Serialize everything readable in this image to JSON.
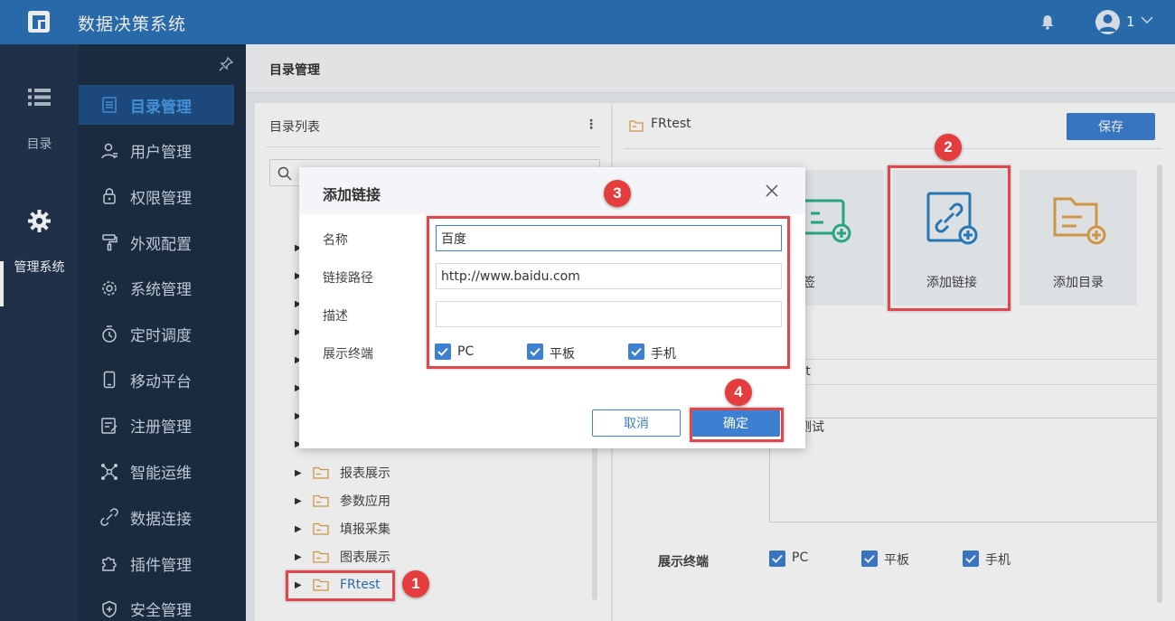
{
  "app": {
    "title": "数据决策系统",
    "user_name": "1"
  },
  "left_strip": {
    "items": [
      {
        "label": "目录"
      },
      {
        "label": "管理系统"
      }
    ]
  },
  "sidebar": {
    "items": [
      {
        "label": "目录管理",
        "icon": "list-icon"
      },
      {
        "label": "用户管理",
        "icon": "user-icon"
      },
      {
        "label": "权限管理",
        "icon": "lock-icon"
      },
      {
        "label": "外观配置",
        "icon": "paint-roller-icon"
      },
      {
        "label": "系统管理",
        "icon": "gear-icon"
      },
      {
        "label": "定时调度",
        "icon": "timer-icon"
      },
      {
        "label": "移动平台",
        "icon": "mobile-icon"
      },
      {
        "label": "注册管理",
        "icon": "register-icon"
      },
      {
        "label": "智能运维",
        "icon": "network-icon"
      },
      {
        "label": "数据连接",
        "icon": "link-icon"
      },
      {
        "label": "插件管理",
        "icon": "puzzle-icon"
      },
      {
        "label": "安全管理",
        "icon": "shield-icon"
      }
    ]
  },
  "content": {
    "header": "目录管理"
  },
  "dir_panel": {
    "title": "目录列表",
    "more": "⋮",
    "tree": [
      "报表展示",
      "参数应用",
      "填报采集",
      "图表展示",
      "FRtest"
    ]
  },
  "right_panel": {
    "folder_name": "FRtest",
    "save_label": "保存",
    "cards": [
      "报标签",
      "添加链接",
      "添加目录"
    ],
    "partial_name": "st",
    "partial_desc": "测试",
    "terminal_label": "展示终端",
    "terminals": [
      "PC",
      "平板",
      "手机"
    ]
  },
  "dialog": {
    "title": "添加链接",
    "name_label": "名称",
    "name_value": "百度",
    "path_label": "链接路径",
    "path_value": "http://www.baidu.com",
    "desc_label": "描述",
    "desc_value": "",
    "terminal_label": "展示终端",
    "terminals": [
      "PC",
      "平板",
      "手机"
    ],
    "cancel_label": "取消",
    "ok_label": "确定"
  },
  "badges": [
    "1",
    "2",
    "3",
    "4"
  ],
  "colors": {
    "topbar": "#2c72b8",
    "accent": "#3d7fd1",
    "highlight": "#e0474c",
    "folder": "#e0a24a"
  }
}
